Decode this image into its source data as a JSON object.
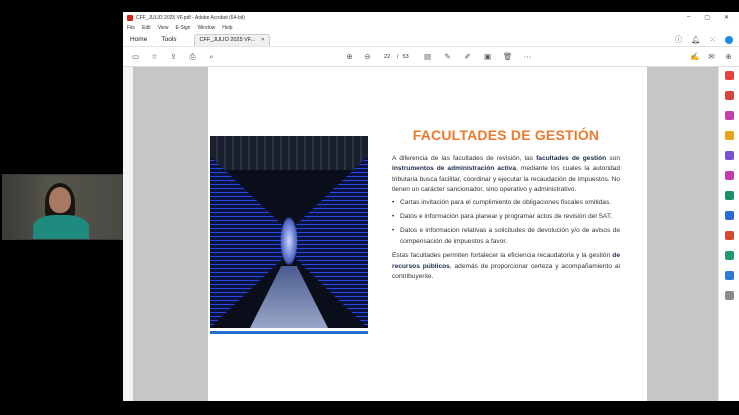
{
  "window": {
    "title": "CFF_JULIO 2025 VF.pdf - Adobe Acrobat (64-bit)",
    "controls": [
      "–",
      "▢",
      "✕"
    ]
  },
  "menu": [
    "File",
    "Edit",
    "View",
    "E-Sign",
    "Window",
    "Help"
  ],
  "tabs": {
    "home": "Home",
    "tools": "Tools",
    "document": "CFF_JULIO 2025 VF...",
    "close": "×"
  },
  "toolbar": {
    "current_page": "22",
    "separator": "/",
    "total_pages": "53"
  },
  "page": {
    "heading": "FACULTADES DE GESTIÓN",
    "para1_a": "A diferencia de las facultades de revisión, las ",
    "para1_b": "facultades de gestión",
    "para1_c": " son ",
    "para1_d": "instrumentos de administración activa",
    "para1_e": ", mediante los cuales la autoridad tributaria busca facilitar, coordinar y ejecutar la recaudación de impuestos. No tienen un carácter sancionador, sino operativo y administrativo.",
    "bullets": [
      "Cartas invitación para el cumplimiento de obligaciones fiscales omitidas.",
      "Datos e información para planear y programar actos de revisión del SAT.",
      "Datos e información relativas a solicitudes de devolución y/o de avisos de compensación de impuestos a favor."
    ],
    "bullet_char": "•",
    "para2_a": "Estas facultades permiten fortalecer la eficiencia recaudatoria y la gestión ",
    "para2_b": "de recursos públicos",
    "para2_c": ", además de proporcionar certeza y acompañamiento al contribuyente."
  },
  "colors": {
    "heading": "#ec7a2d",
    "accent_bar": "#1f6fd0",
    "viewer_bg": "#c6c6c6"
  }
}
